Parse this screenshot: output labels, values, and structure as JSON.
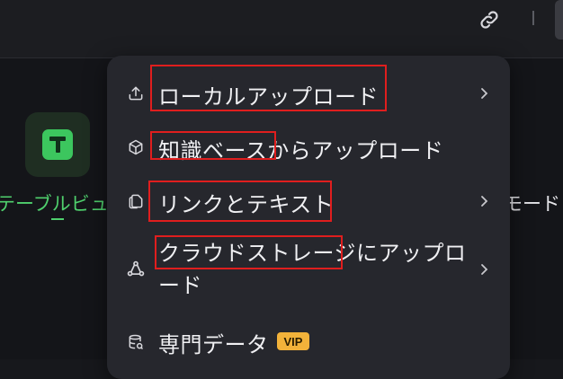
{
  "topbar": {
    "link_icon": "link-icon"
  },
  "workspace": {
    "left_app": {
      "icon": "table-app-icon",
      "label": "テーブルビュー",
      "color": "#3cc65e"
    },
    "right_label": "モード"
  },
  "menu": {
    "items": [
      {
        "id": "local-upload",
        "icon": "upload-icon",
        "label": "ローカルアップロード",
        "has_submenu": true
      },
      {
        "id": "kb-upload",
        "icon": "cube-icon",
        "label": "知識ベースからアップロード",
        "has_submenu": false
      },
      {
        "id": "link-text",
        "icon": "documents-icon",
        "label": "リンクとテキスト",
        "has_submenu": true
      },
      {
        "id": "cloud-upload",
        "icon": "cloud-share-icon",
        "label": "クラウドストレージにアップロード",
        "has_submenu": true
      },
      {
        "id": "pro-data",
        "icon": "database-icon",
        "label": "専門データ",
        "badge": "VIP",
        "has_submenu": false
      }
    ]
  },
  "colors": {
    "accent_green": "#4fd06d",
    "vip_badge": "#f2b23a",
    "annotation_red": "#e01e1e",
    "menu_bg": "#26272d"
  }
}
